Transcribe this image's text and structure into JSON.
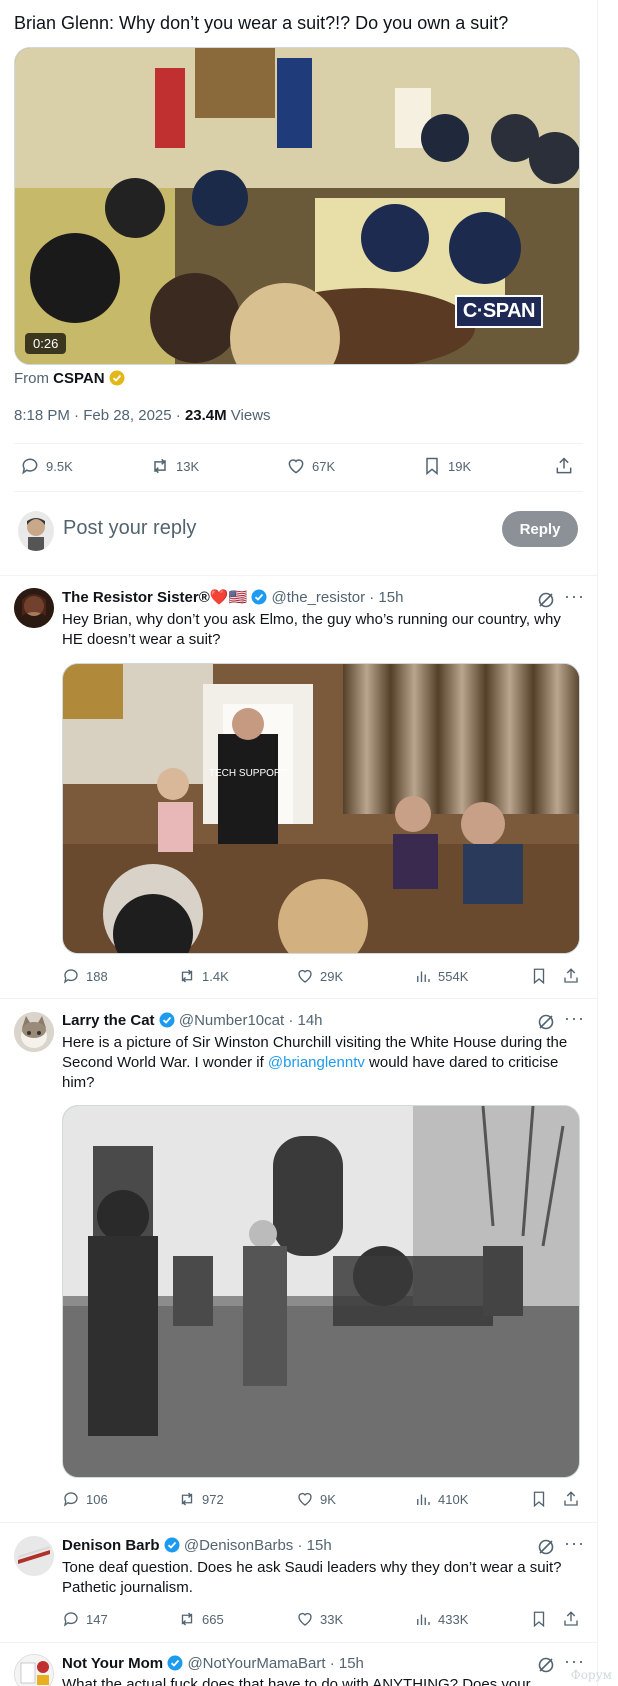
{
  "main_post": {
    "text": "Brian Glenn: Why don’t you wear a suit?!? Do you own a suit?",
    "video_duration": "0:26",
    "video_logo": "C·SPAN",
    "from_label": "From",
    "from_source": "CSPAN",
    "timestamp": "8:18 PM · Feb 28, 2025 · ",
    "views_count": "23.4M",
    "views_label": " Views",
    "stats": {
      "replies": "9.5K",
      "reposts": "13K",
      "likes": "67K",
      "bookmarks": "19K"
    }
  },
  "reply_box": {
    "placeholder": "Post your reply",
    "button": "Reply"
  },
  "replies": [
    {
      "name": "The Resistor Sister®",
      "emoji": "❤️🇺🇸",
      "handle": "@the_resistor",
      "time": "· 15h",
      "text": "Hey Brian, why don’t you ask Elmo, the guy who’s running our country, why HE doesn’t wear a suit?",
      "photo_caption": "TECH SUPPORT",
      "stats": {
        "replies": "188",
        "reposts": "1.4K",
        "likes": "29K",
        "views": "554K"
      }
    },
    {
      "name": "Larry the Cat",
      "handle": "@Number10cat",
      "time": "· 14h",
      "text_before": "Here is a picture of Sir Winston Churchill visiting the White House during the Second World War. I wonder if ",
      "mention": "@brianglenntv",
      "text_after": " would have dared to criticise him?",
      "stats": {
        "replies": "106",
        "reposts": "972",
        "likes": "9K",
        "views": "410K"
      }
    },
    {
      "name": "Denison Barb",
      "handle": "@DenisonBarbs",
      "time": "· 15h",
      "text": "Tone deaf question. Does he ask Saudi leaders why they don’t wear a suit? Pathetic journalism.",
      "stats": {
        "replies": "147",
        "reposts": "665",
        "likes": "33K",
        "views": "433K"
      }
    },
    {
      "name": "Not Your Mom",
      "handle": "@NotYourMamaBart",
      "time": "· 15h",
      "text": "What the actual fuck does that have to do with ANYTHING? Does your"
    }
  ],
  "watermark": "Форум",
  "colors": {
    "accent": "#1d9bf0",
    "text": "#0f1419",
    "muted": "#536471",
    "border": "#eff3f4",
    "verified_gold": "#e2b719"
  }
}
